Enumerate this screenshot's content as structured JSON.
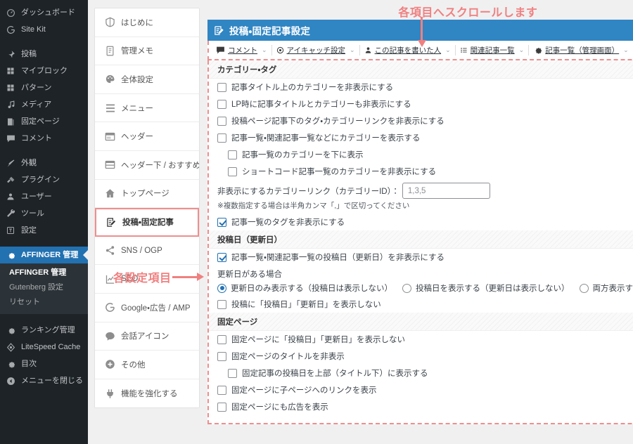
{
  "colors": {
    "wp_sidebar_bg": "#1d2327",
    "wp_active": "#2271b1",
    "panel_header": "#3085c3",
    "annotation": "#f08080",
    "highlight_border": "#ef8e8e"
  },
  "wp_sidebar": {
    "groups": [
      {
        "items": [
          {
            "label": "ダッシュボード",
            "icon": "dashboard-icon",
            "active": false
          },
          {
            "label": "Site Kit",
            "icon": "sitekit-icon",
            "active": false
          }
        ]
      },
      {
        "items": [
          {
            "label": "投稿",
            "icon": "pin-icon",
            "active": false
          },
          {
            "label": "マイブロック",
            "icon": "blocks-icon",
            "active": false
          },
          {
            "label": "パターン",
            "icon": "blocks-icon",
            "active": false
          },
          {
            "label": "メディア",
            "icon": "media-icon",
            "active": false
          },
          {
            "label": "固定ページ",
            "icon": "pages-icon",
            "active": false
          },
          {
            "label": "コメント",
            "icon": "comment-icon",
            "active": false
          }
        ]
      },
      {
        "items": [
          {
            "label": "外観",
            "icon": "appearance-icon",
            "active": false
          },
          {
            "label": "プラグイン",
            "icon": "plugin-icon",
            "active": false
          },
          {
            "label": "ユーザー",
            "icon": "user-icon",
            "active": false
          },
          {
            "label": "ツール",
            "icon": "tools-icon",
            "active": false
          },
          {
            "label": "設定",
            "icon": "settings-icon",
            "active": false
          }
        ]
      },
      {
        "items": [
          {
            "label": "AFFINGER 管理",
            "icon": "gear-icon",
            "active": true
          }
        ]
      }
    ],
    "submenu": [
      {
        "label": "AFFINGER 管理",
        "current": true
      },
      {
        "label": "Gutenberg 設定",
        "current": false
      },
      {
        "label": "リセット",
        "current": false
      }
    ],
    "bottom_items": [
      {
        "label": "ランキング管理",
        "icon": "gear-icon"
      },
      {
        "label": "LiteSpeed Cache",
        "icon": "litespeed-icon"
      },
      {
        "label": "目次",
        "icon": "gear-icon"
      },
      {
        "label": "メニューを閉じる",
        "icon": "collapse-icon"
      }
    ]
  },
  "settings_nav": {
    "items": [
      {
        "label": "はじめに",
        "icon": "shield-icon",
        "selected": false
      },
      {
        "label": "管理メモ",
        "icon": "memo-icon",
        "selected": false
      },
      {
        "label": "全体設定",
        "icon": "palette-icon",
        "selected": false
      },
      {
        "label": "メニュー",
        "icon": "hamburger-icon",
        "selected": false
      },
      {
        "label": "ヘッダー",
        "icon": "header-icon",
        "selected": false
      },
      {
        "label": "ヘッダー下 / おすすめ",
        "icon": "header-below-icon",
        "selected": false
      },
      {
        "label": "トップページ",
        "icon": "home-icon",
        "selected": false
      },
      {
        "label": "投稿・固定記事",
        "icon": "post-edit-icon",
        "selected": true
      },
      {
        "label": "SNS / OGP",
        "icon": "share-icon",
        "selected": false
      },
      {
        "label": "SEO",
        "icon": "chart-icon",
        "selected": false
      },
      {
        "label": "Google・広告 / AMP",
        "icon": "google-icon",
        "selected": false
      },
      {
        "label": "会話アイコン",
        "icon": "speech-bubble-icon",
        "selected": false
      },
      {
        "label": "その他",
        "icon": "plus-circle-icon",
        "selected": false
      },
      {
        "label": "機能を強化する",
        "icon": "plug-icon",
        "selected": false
      }
    ]
  },
  "panel": {
    "title": "投稿・固定記事設定",
    "title_icon": "post-edit-icon",
    "jump_links": [
      {
        "label": "コメント",
        "icon": "comment-icon",
        "caret": "⌄"
      },
      {
        "label": "アイキャッチ設定",
        "icon": "eyecatch-icon",
        "caret": "⌄"
      },
      {
        "label": "この記事を書いた人",
        "icon": "person-icon",
        "caret": "⌄"
      },
      {
        "label": "関連記事一覧",
        "icon": "list-icon",
        "caret": "⌄"
      },
      {
        "label": "記事一覧（管理画面）",
        "icon": "gear-icon",
        "caret": "⌄"
      }
    ]
  },
  "sections": [
    {
      "heading": "カテゴリー・タグ",
      "rows": [
        {
          "type": "checkbox",
          "label": "記事タイトル上のカテゴリーを非表示にする",
          "checked": false,
          "indent": false
        },
        {
          "type": "checkbox",
          "label": "LP時に記事タイトルとカテゴリーも非表示にする",
          "checked": false,
          "indent": false
        },
        {
          "type": "checkbox",
          "label": "投稿ページ記事下のタグ・カテゴリーリンクを非表示にする",
          "checked": false,
          "indent": false
        },
        {
          "type": "checkbox",
          "label": "記事一覧・関連記事一覧などにカテゴリーを表示する",
          "checked": false,
          "indent": false
        },
        {
          "type": "checkbox",
          "label": "記事一覧のカテゴリーを下に表示",
          "checked": false,
          "indent": true
        },
        {
          "type": "checkbox",
          "label": "ショートコード記事一覧のカテゴリーを非表示にする",
          "checked": false,
          "indent": true
        },
        {
          "type": "field",
          "label": "非表示にするカテゴリーリンク（カテゴリーID）：",
          "value": "",
          "placeholder": "1,3,5"
        },
        {
          "type": "note",
          "label": "※複数指定する場合は半角カンマ「,」で区切ってください"
        },
        {
          "type": "checkbox",
          "label": "記事一覧のタグを非表示にする",
          "checked": true,
          "indent": false
        }
      ]
    },
    {
      "heading": "投稿日（更新日）",
      "rows": [
        {
          "type": "checkbox",
          "label": "記事一覧・関連記事一覧の投稿日（更新日）を非表示にする",
          "checked": true,
          "indent": false
        },
        {
          "type": "sublabel",
          "label": "更新日がある場合"
        },
        {
          "type": "radiogroup",
          "options": [
            {
              "label": "更新日のみ表示する（投稿日は表示しない）",
              "checked": true
            },
            {
              "label": "投稿日を表示する（更新日は表示しない）",
              "checked": false
            },
            {
              "label": "両方表示する（※一覧を除く）",
              "checked": false
            }
          ]
        },
        {
          "type": "checkbox",
          "label": "投稿に「投稿日」「更新日」を表示しない",
          "checked": false,
          "indent": false
        }
      ]
    },
    {
      "heading": "固定ページ",
      "rows": [
        {
          "type": "checkbox",
          "label": "固定ページに「投稿日」「更新日」を表示しない",
          "checked": false,
          "indent": false
        },
        {
          "type": "checkbox",
          "label": "固定ページのタイトルを非表示",
          "checked": false,
          "indent": false
        },
        {
          "type": "checkbox",
          "label": "固定記事の投稿日を上部（タイトル下）に表示する",
          "checked": false,
          "indent": true
        },
        {
          "type": "checkbox",
          "label": "固定ページに子ページへのリンクを表示",
          "checked": false,
          "indent": false
        },
        {
          "type": "checkbox",
          "label": "固定ページにも広告を表示",
          "checked": false,
          "indent": false
        }
      ]
    }
  ],
  "annotations": {
    "top": "各項目へスクロールします",
    "left": "各設定項目"
  }
}
